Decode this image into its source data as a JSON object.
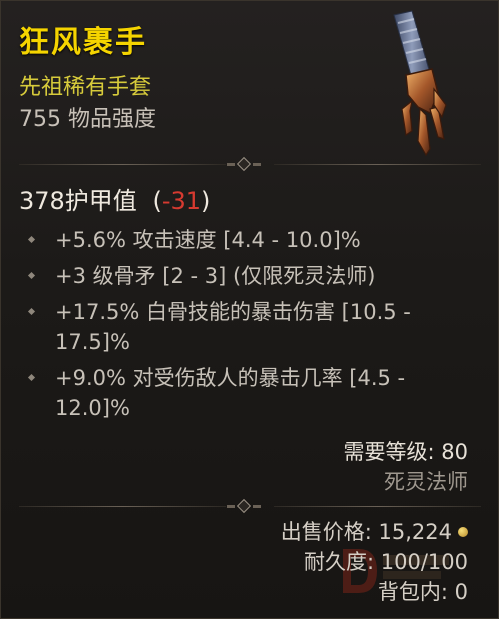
{
  "item": {
    "name": "狂风裹手",
    "type": "先祖稀有手套",
    "power": "755 物品强度"
  },
  "armor": {
    "label": "378护甲值",
    "delta_open": "(",
    "delta": "-31",
    "delta_close": ")"
  },
  "affixes": [
    {
      "line1": "+5.6% 攻击速度 [4.4 - 10.0]%",
      "line2": ""
    },
    {
      "line1": "+3 级骨矛 [2 - 3] (仅限死灵法师)",
      "line2": ""
    },
    {
      "line1": "+17.5% 白骨技能的暴击伤害 [10.5 -",
      "line2": "17.5]%"
    },
    {
      "line1": "+9.0% 对受伤敌人的暴击几率 [4.5 -",
      "line2": "12.0]%"
    }
  ],
  "requirements": {
    "level": "需要等级: 80",
    "class": "死灵法师"
  },
  "footer": {
    "sell": "出售价格: 15,224",
    "durability": "耐久度: 100/100",
    "bag": "背包内: 0"
  },
  "colors": {
    "name": "#f5d400",
    "rarity": "#d7cb3b",
    "negative": "#d63a30",
    "background": "#1b1816"
  },
  "icons": {
    "item_art": "gauntlet-icon",
    "bullet": "diamond-bullet-icon",
    "currency": "gold-coin-icon",
    "divider_ornament": "diamond-ornament-icon"
  }
}
